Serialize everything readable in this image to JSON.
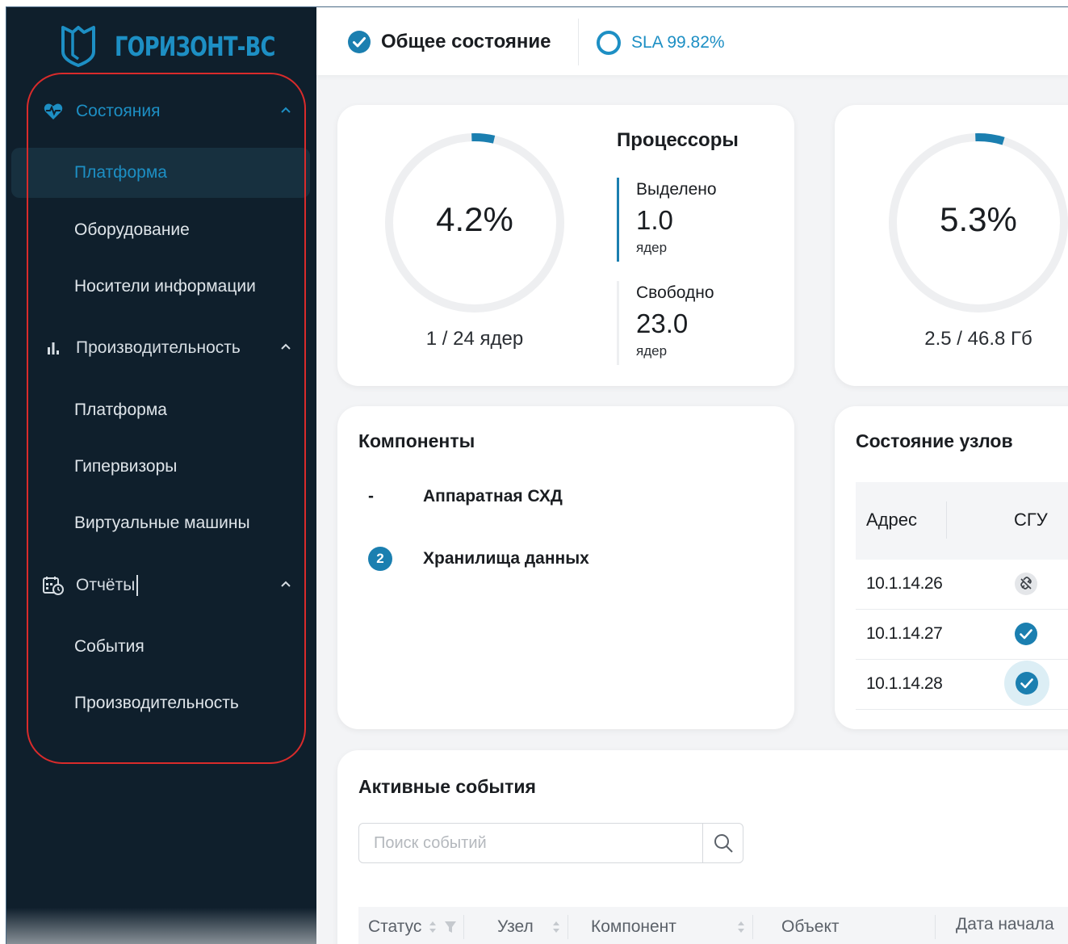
{
  "app": {
    "logo_text": "ГОРИЗОНТ-ВС"
  },
  "sidebar": {
    "groups": [
      {
        "label": "Состояния",
        "items": [
          "Платформа",
          "Оборудование",
          "Носители информации"
        ]
      },
      {
        "label": "Производительность",
        "items": [
          "Платформа",
          "Гипервизоры",
          "Виртуальные машины"
        ]
      },
      {
        "label": "Отчёты",
        "items": [
          "События",
          "Производительность"
        ]
      }
    ],
    "selected_item": "Платформа",
    "colors": {
      "accent": "#1d8fc4",
      "background": "#0f1f2c",
      "highlight_outline": "#d92b2b"
    }
  },
  "header": {
    "overall_status": "Общее состояние",
    "sla": "SLA 99.82%"
  },
  "cpu_card": {
    "gauge_value": "4.2%",
    "gauge_fraction": 0.042,
    "gauge_caption": "1 / 24 ядер",
    "title": "Процессоры",
    "allocated": {
      "label": "Выделено",
      "value": "1.0",
      "unit": "ядер"
    },
    "free": {
      "label": "Свободно",
      "value": "23.0",
      "unit": "ядер"
    }
  },
  "memory_card": {
    "gauge_value": "5.3%",
    "gauge_fraction": 0.053,
    "gauge_caption": "2.5 / 46.8 Гб"
  },
  "components": {
    "title": "Компоненты",
    "rows": [
      {
        "marker": "-",
        "label": "Аппаратная СХД"
      },
      {
        "marker": "2",
        "label": "Хранилища данных"
      }
    ]
  },
  "nodes": {
    "title": "Состояние узлов",
    "columns": [
      "Адрес",
      "СГУ"
    ],
    "rows": [
      {
        "address": "10.1.14.26",
        "status": "disconnected"
      },
      {
        "address": "10.1.14.27",
        "status": "ok"
      },
      {
        "address": "10.1.14.28",
        "status": "ok"
      }
    ]
  },
  "events": {
    "title": "Активные события",
    "search_placeholder": "Поиск событий",
    "columns": [
      "Статус",
      "Узел",
      "Компонент",
      "Объект",
      "Дата начала"
    ]
  }
}
